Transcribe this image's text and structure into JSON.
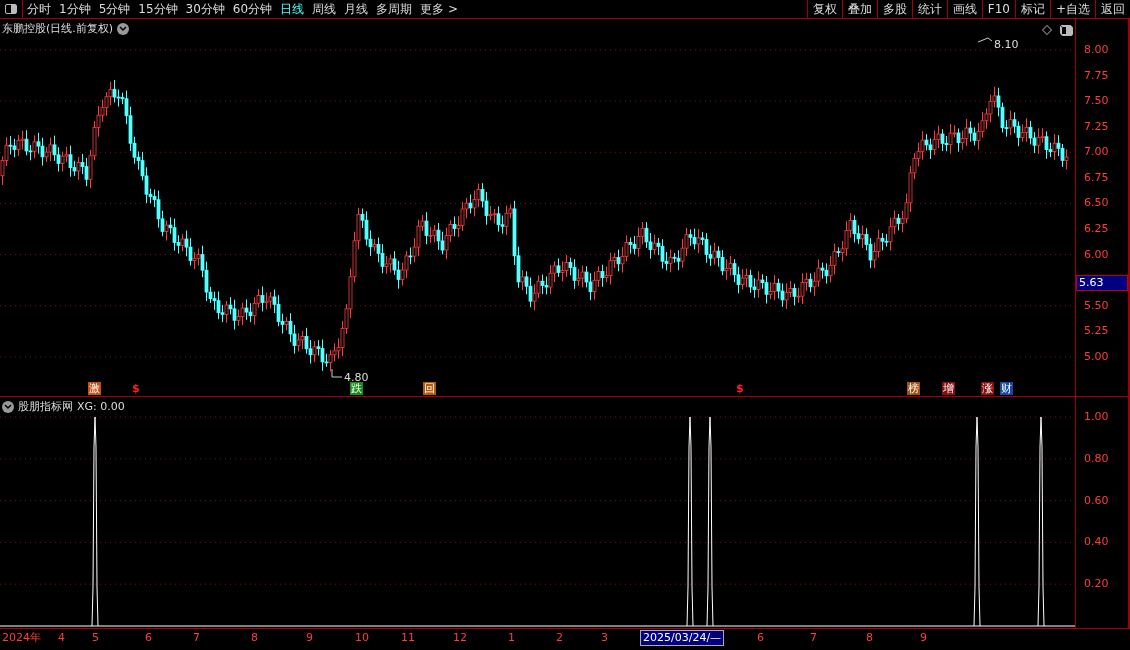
{
  "toolbar": {
    "periods": [
      {
        "label": "分时",
        "selected": false
      },
      {
        "label": "1分钟",
        "selected": false
      },
      {
        "label": "5分钟",
        "selected": false
      },
      {
        "label": "15分钟",
        "selected": false
      },
      {
        "label": "30分钟",
        "selected": false
      },
      {
        "label": "60分钟",
        "selected": false
      },
      {
        "label": "日线",
        "selected": true
      },
      {
        "label": "周线",
        "selected": false
      },
      {
        "label": "月线",
        "selected": false
      },
      {
        "label": "多周期",
        "selected": false
      },
      {
        "label": "更多 >",
        "selected": false
      }
    ],
    "buttons": [
      "复权",
      "叠加",
      "多股",
      "统计",
      "画线",
      "F10",
      "标记",
      "+自选",
      "返回"
    ]
  },
  "main_panel": {
    "title": "东鹏控股(日线.前复权)",
    "price_axis": [
      "8.00",
      "7.75",
      "7.50",
      "7.25",
      "7.00",
      "6.75",
      "6.50",
      "6.25",
      "6.00",
      "5.50",
      "5.25",
      "5.00"
    ],
    "current_price": "5.63",
    "high_label": "8.10",
    "low_label": "4.80",
    "markers": [
      {
        "text": "激",
        "kind": "badge",
        "color": "#c0501a"
      },
      {
        "text": "$",
        "kind": "sign",
        "color": "#ff2020"
      },
      {
        "text": "跌",
        "kind": "badge",
        "color": "#1a8a1a"
      },
      {
        "text": "回",
        "kind": "badge",
        "color": "#b05a10"
      },
      {
        "text": "$",
        "kind": "sign",
        "color": "#ff2020"
      },
      {
        "text": "榜",
        "kind": "badge",
        "color": "#a05010"
      },
      {
        "text": "增",
        "kind": "badge",
        "color": "#8a1010"
      },
      {
        "text": "涨",
        "kind": "badge",
        "color": "#8a1010"
      },
      {
        "text": "财",
        "kind": "badge",
        "color": "#1a4aa0"
      }
    ]
  },
  "indicator_panel": {
    "title": "股朋指标网",
    "reading": "XG: 0.00",
    "axis": [
      "1.00",
      "0.80",
      "0.60",
      "0.40",
      "0.20"
    ]
  },
  "date_axis": [
    {
      "label": "2024年",
      "selected": false
    },
    {
      "label": "4",
      "selected": false
    },
    {
      "label": "5",
      "selected": false
    },
    {
      "label": "6",
      "selected": false
    },
    {
      "label": "7",
      "selected": false
    },
    {
      "label": "8",
      "selected": false
    },
    {
      "label": "9",
      "selected": false
    },
    {
      "label": "10",
      "selected": false
    },
    {
      "label": "11",
      "selected": false
    },
    {
      "label": "12",
      "selected": false
    },
    {
      "label": "1",
      "selected": false
    },
    {
      "label": "2",
      "selected": false
    },
    {
      "label": "3",
      "selected": false
    },
    {
      "label": "2025/03/24/—",
      "selected": true
    },
    {
      "label": "6",
      "selected": false
    },
    {
      "label": "7",
      "selected": false
    },
    {
      "label": "8",
      "selected": false
    },
    {
      "label": "9",
      "selected": false
    }
  ]
}
